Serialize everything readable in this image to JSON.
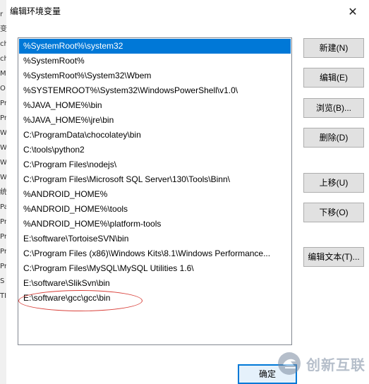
{
  "background_window": {
    "edge_glyphs": [
      "r",
      "变",
      "ch",
      "ch",
      "M",
      "O",
      "Pr",
      "Pr",
      "W",
      "W",
      "W",
      "W",
      "统",
      "Pa",
      "Pr",
      "Pr",
      "Pr",
      "Pr",
      "S",
      "TI"
    ]
  },
  "dialog": {
    "title": "编辑环境变量",
    "close_label": "✕",
    "path_entries": [
      "%SystemRoot%\\system32",
      "%SystemRoot%",
      "%SystemRoot%\\System32\\Wbem",
      "%SYSTEMROOT%\\System32\\WindowsPowerShell\\v1.0\\",
      "%JAVA_HOME%\\bin",
      "%JAVA_HOME%\\jre\\bin",
      "C:\\ProgramData\\chocolatey\\bin",
      "C:\\tools\\python2",
      "C:\\Program Files\\nodejs\\",
      "C:\\Program Files\\Microsoft SQL Server\\130\\Tools\\Binn\\",
      "%ANDROID_HOME%",
      "%ANDROID_HOME%\\tools",
      "%ANDROID_HOME%\\platform-tools",
      "E:\\software\\TortoiseSVN\\bin",
      "C:\\Program Files (x86)\\Windows Kits\\8.1\\Windows Performance...",
      "C:\\Program Files\\MySQL\\MySQL Utilities 1.6\\",
      "E:\\software\\SlikSvn\\bin",
      "E:\\software\\gcc\\gcc\\bin"
    ],
    "selected_index": 0,
    "buttons": {
      "new": "新建(N)",
      "edit": "编辑(E)",
      "browse": "浏览(B)...",
      "delete": "删除(D)",
      "move_up": "上移(U)",
      "move_down": "下移(O)",
      "edit_text": "编辑文本(T)...",
      "ok": "确定"
    },
    "colors": {
      "selection": "#0078d7",
      "annotation": "#d9413b"
    }
  },
  "watermark": {
    "text": "创新互联"
  }
}
